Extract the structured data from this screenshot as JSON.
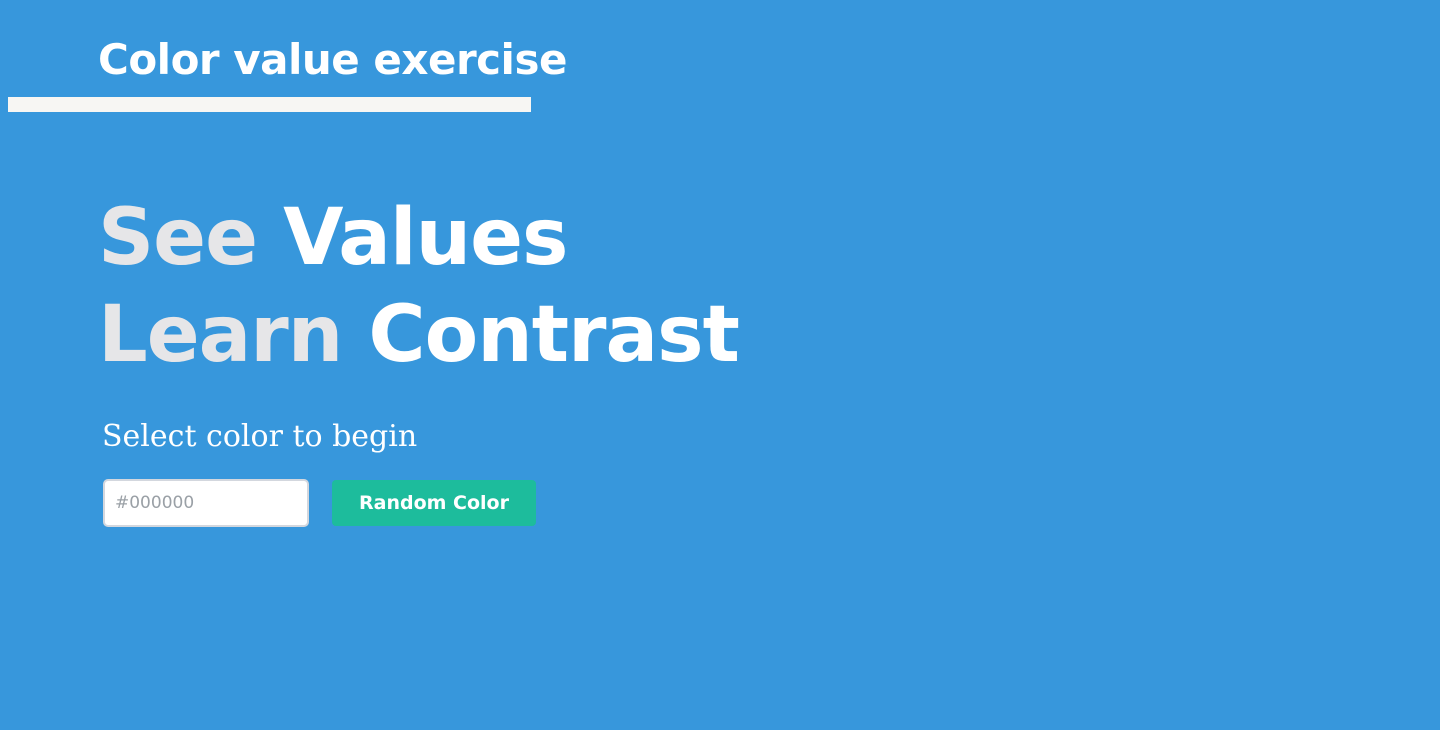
{
  "header": {
    "title": "Color value exercise"
  },
  "hero": {
    "line1_word1": "See",
    "line1_word2": "Values",
    "line2_word1": "Learn",
    "line2_word2": "Contrast"
  },
  "picker": {
    "prompt": "Select color to begin",
    "input_placeholder": "#000000",
    "input_value": "",
    "random_button_label": "Random Color"
  },
  "colors": {
    "background": "#3797dc",
    "underline": "#f7f6f3",
    "button": "#1dbc9c",
    "hero_muted": "#e6e6e8",
    "hero_bright": "#ffffff"
  }
}
